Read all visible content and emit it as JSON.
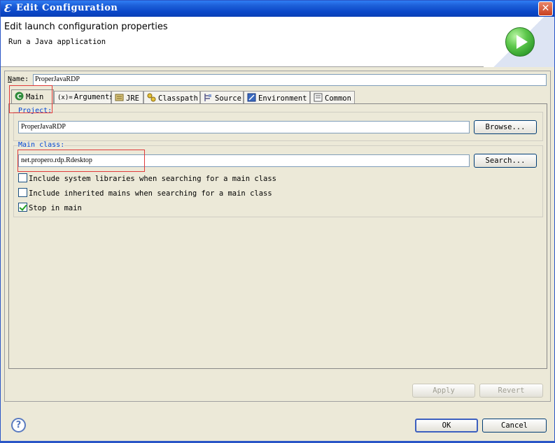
{
  "window": {
    "title": "Edit Configuration",
    "icon_glyph": "Ɛ",
    "close_glyph": "✕"
  },
  "header": {
    "title": "Edit launch configuration properties",
    "subtitle": "Run a Java application",
    "icon": "run-icon"
  },
  "name_field": {
    "label_mnemonic": "N",
    "label_rest": "ame:",
    "value": "ProperJavaRDP"
  },
  "tabs": [
    {
      "label": "Main",
      "icon": "main-class-icon",
      "active": true
    },
    {
      "label": "Arguments",
      "icon": "arguments-icon",
      "icon_glyph": "(x)="
    },
    {
      "label": "JRE",
      "icon": "jre-icon"
    },
    {
      "label": "Classpath",
      "icon": "classpath-icon"
    },
    {
      "label": "Source",
      "icon": "source-icon"
    },
    {
      "label": "Environment",
      "icon": "environment-icon"
    },
    {
      "label": "Common",
      "icon": "common-icon"
    }
  ],
  "main": {
    "project_label": "Project:",
    "project_value": "ProperJavaRDP",
    "browse_label": "Browse...",
    "main_class_label": "Main class:",
    "main_class_value": "net.propero.rdp.Rdesktop",
    "search_label": "Search...",
    "options": [
      {
        "label": "Include system libraries when searching for a main class",
        "checked": false
      },
      {
        "label": "Include inherited mains when searching for a main class",
        "checked": false
      },
      {
        "label": "Stop in main",
        "checked": true
      }
    ]
  },
  "footer": {
    "apply_label": "Apply",
    "revert_label": "Revert",
    "ok_label": "OK",
    "cancel_label": "Cancel",
    "help_glyph": "?"
  },
  "colors": {
    "titlebar": "#0a47c8",
    "highlight_box": "#e03a3a",
    "link_label": "#0046d5"
  }
}
